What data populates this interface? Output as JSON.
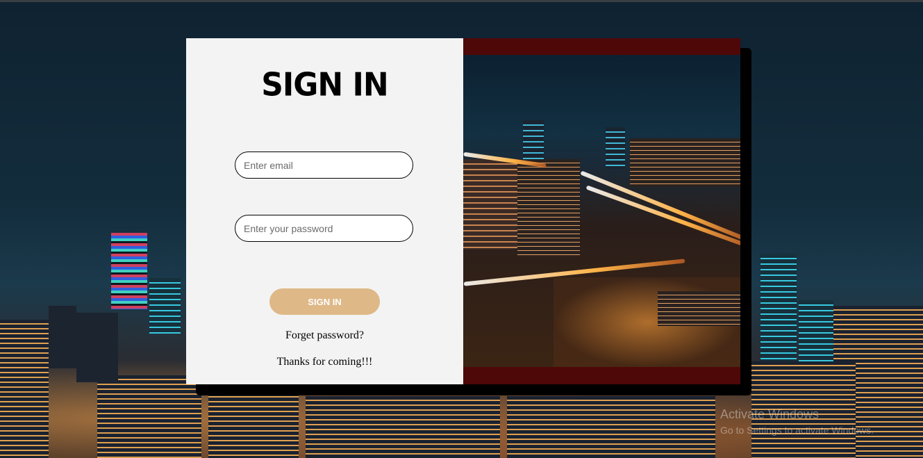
{
  "form": {
    "title": "SIGN IN",
    "email_placeholder": "Enter email",
    "password_placeholder": "Enter your password",
    "submit_label": "SIGN IN",
    "forgot_link": "Forget password?",
    "footer_text": "Thanks for coming!!!"
  },
  "watermark": {
    "line1": "Activate Windows",
    "line2": "Go to Settings to activate Windows."
  },
  "colors": {
    "left_panel_bg": "#f3f3f3",
    "button_bg": "#deb887",
    "right_panel_frame": "#4e0808",
    "shadow": "#000000"
  }
}
